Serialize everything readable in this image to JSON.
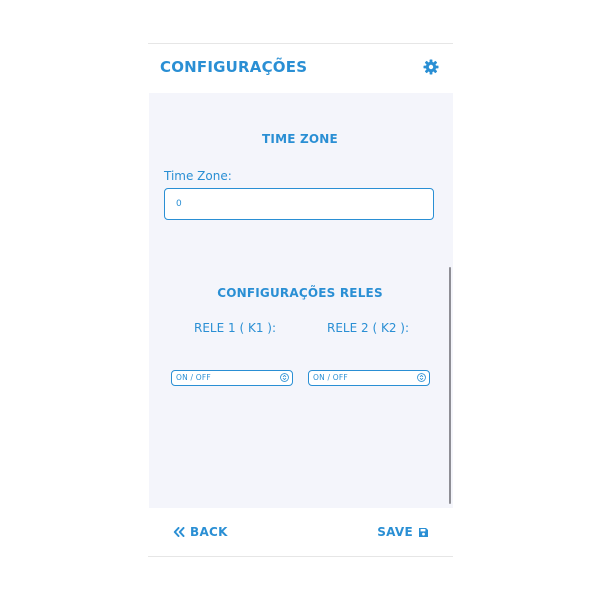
{
  "colors": {
    "accent": "#2a8fd4",
    "content_bg": "#f4f5fb",
    "scrollbar": "#8e8e95"
  },
  "header": {
    "title": "CONFIGURAÇÕES",
    "icon": "gear-icon"
  },
  "timezone": {
    "section_title": "TIME ZONE",
    "field_label": "Time Zone:",
    "value": "0"
  },
  "relays": {
    "section_title": "CONFIGURAÇÕES RELES",
    "relay1": {
      "label": "RELE 1 ( K1 ):",
      "selected": "ON / OFF"
    },
    "relay2": {
      "label": "RELE 2 ( K2 ):",
      "selected": "ON / OFF"
    }
  },
  "footer": {
    "back_label": "BACK",
    "back_icon": "double-chevron-left-icon",
    "save_label": "SAVE",
    "save_icon": "floppy-disk-icon"
  }
}
